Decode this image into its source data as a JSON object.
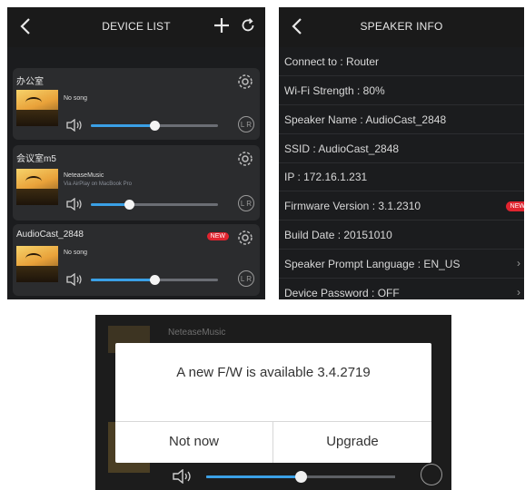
{
  "device_list": {
    "title": "DEVICE LIST",
    "devices": [
      {
        "name": "办公室",
        "song": "No song",
        "source": "",
        "volume": 0.5,
        "new_badge": ""
      },
      {
        "name": "会议室m5",
        "song": "NeteaseMusic",
        "source": "Via AirPlay on MacBook Pro",
        "volume": 0.3,
        "new_badge": ""
      },
      {
        "name": "AudioCast_2848",
        "song": "No song",
        "source": "",
        "volume": 0.5,
        "new_badge": "NEW"
      }
    ],
    "lr_label": "L R"
  },
  "speaker_info": {
    "title": "SPEAKER INFO",
    "rows": [
      {
        "label": "Connect to : Router"
      },
      {
        "label": "Wi-Fi Strength : 80%"
      },
      {
        "label": "Speaker Name : AudioCast_2848"
      },
      {
        "label": "SSID : AudioCast_2848"
      },
      {
        "label": "IP : 172.16.1.231"
      },
      {
        "label": "Firmware Version : 3.1.2310"
      },
      {
        "label": "Build Date : 20151010"
      },
      {
        "label": "Speaker Prompt Language : EN_US"
      },
      {
        "label": "Device Password : OFF"
      }
    ],
    "new_badge": "NEW"
  },
  "dialog": {
    "background_music": "NeteaseMusic",
    "message": "A new F/W is available  3.4.2719",
    "not_now": "Not now",
    "upgrade": "Upgrade",
    "volume": 0.5
  },
  "colors": {
    "accent": "#3aa0e6",
    "badge": "#e0242f",
    "panel": "#1b1c1e",
    "card": "#2b2c2e"
  }
}
